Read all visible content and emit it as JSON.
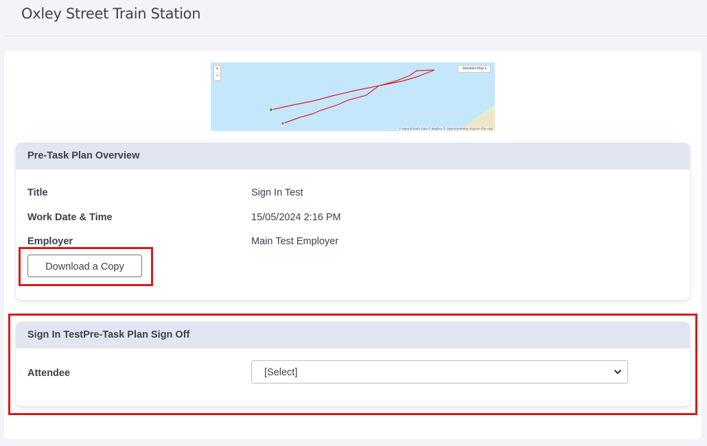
{
  "page": {
    "title": "Oxley Street Train Station"
  },
  "map": {
    "zoom_in": "+",
    "zoom_out": "−",
    "style_select": "Standard Map ▾",
    "attribution": "© Natural Earth Data © Mapbox © OpenStreetMap Improve this map",
    "track_color": "#e0192b",
    "start_marker_color": "#2fa83a"
  },
  "overview": {
    "header": "Pre-Task Plan Overview",
    "fields": [
      {
        "label": "Title",
        "value": "Sign In Test"
      },
      {
        "label": "Work Date & Time",
        "value": "15/05/2024 2:16 PM"
      },
      {
        "label": "Employer",
        "value": "Main Test Employer"
      }
    ],
    "download_label": "Download a Copy"
  },
  "signoff": {
    "header": "Sign In TestPre-Task Plan Sign Off",
    "attendee_label": "Attendee",
    "attendee_selected": "[Select]"
  },
  "highlight_color": "#d41a1a"
}
